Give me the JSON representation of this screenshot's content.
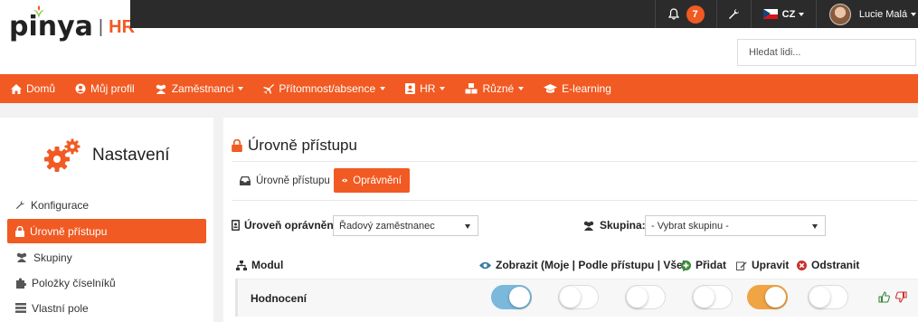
{
  "header": {
    "logo_text": "pinya",
    "logo_sep": "|",
    "logo_hr": "HR",
    "notification_count": "7",
    "language": "CZ",
    "user_name": "Lucie Malá",
    "search_placeholder": "Hledat lidi..."
  },
  "nav": {
    "items": [
      {
        "label": "Domů",
        "icon": "home-icon"
      },
      {
        "label": "Můj profil",
        "icon": "user-circle-icon"
      },
      {
        "label": "Zaměstnanci",
        "icon": "users-icon"
      },
      {
        "label": "Přítomnost/absence",
        "icon": "plane-icon"
      },
      {
        "label": "HR",
        "icon": "id-card-icon"
      },
      {
        "label": "Různé",
        "icon": "cubes-icon"
      },
      {
        "label": "E-learning",
        "icon": "graduation-cap-icon"
      }
    ]
  },
  "sidebar": {
    "title": "Nastavení",
    "items": [
      {
        "label": "Konfigurace",
        "icon": "wrench-icon"
      },
      {
        "label": "Úrovně přístupu",
        "icon": "lock-icon"
      },
      {
        "label": "Skupiny",
        "icon": "users-icon"
      },
      {
        "label": "Položky číselníků",
        "icon": "puzzle-icon"
      },
      {
        "label": "Vlastní pole",
        "icon": "list-icon"
      }
    ]
  },
  "main": {
    "title": "Úrovně přístupu",
    "tabs": [
      {
        "label": "Úrovně přístupu",
        "icon": "inbox-icon"
      },
      {
        "label": "Oprávnění",
        "icon": "eye-icon"
      }
    ],
    "filters": {
      "level_label": "Úroveň oprávnění:",
      "level_value": "Řadový zaměstnanec",
      "group_label": "Skupina:",
      "group_value": "- Vybrat skupinu -"
    },
    "table": {
      "columns": {
        "module": "Modul",
        "view": "Zobrazit (Moje | Podle přístupu | Vše)",
        "add": "Přidat",
        "edit": "Upravit",
        "delete": "Odstranit"
      },
      "rows": [
        {
          "module": "Hodnocení",
          "toggles": [
            {
              "state": "on",
              "color": "#7ab8dc"
            },
            {
              "state": "off"
            },
            {
              "state": "off"
            },
            {
              "state": "off"
            },
            {
              "state": "on",
              "color": "#f0a444"
            },
            {
              "state": "off"
            }
          ]
        }
      ]
    }
  },
  "colors": {
    "accent": "#f15a22",
    "topbar": "#2b2b2b"
  }
}
